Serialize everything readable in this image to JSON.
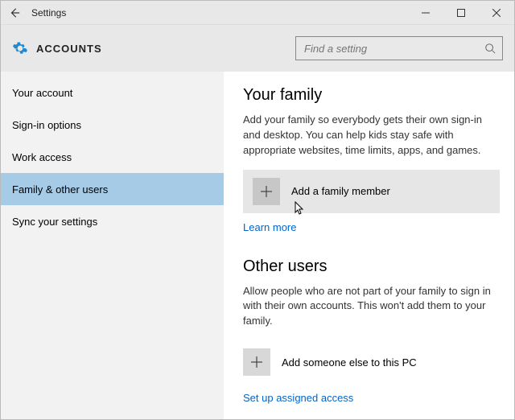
{
  "titlebar": {
    "title": "Settings"
  },
  "header": {
    "page_title": "ACCOUNTS",
    "search_placeholder": "Find a setting"
  },
  "sidebar": {
    "items": [
      {
        "label": "Your account"
      },
      {
        "label": "Sign-in options"
      },
      {
        "label": "Work access"
      },
      {
        "label": "Family & other users"
      },
      {
        "label": "Sync your settings"
      }
    ],
    "selected_index": 3
  },
  "content": {
    "family": {
      "title": "Your family",
      "description": "Add your family so everybody gets their own sign-in and desktop. You can help kids stay safe with appropriate websites, time limits, apps, and games.",
      "add_label": "Add a family member",
      "learn_more": "Learn more"
    },
    "other_users": {
      "title": "Other users",
      "description": "Allow people who are not part of your family to sign in with their own accounts. This won't add them to your family.",
      "add_label": "Add someone else to this PC",
      "assigned_access": "Set up assigned access"
    }
  }
}
